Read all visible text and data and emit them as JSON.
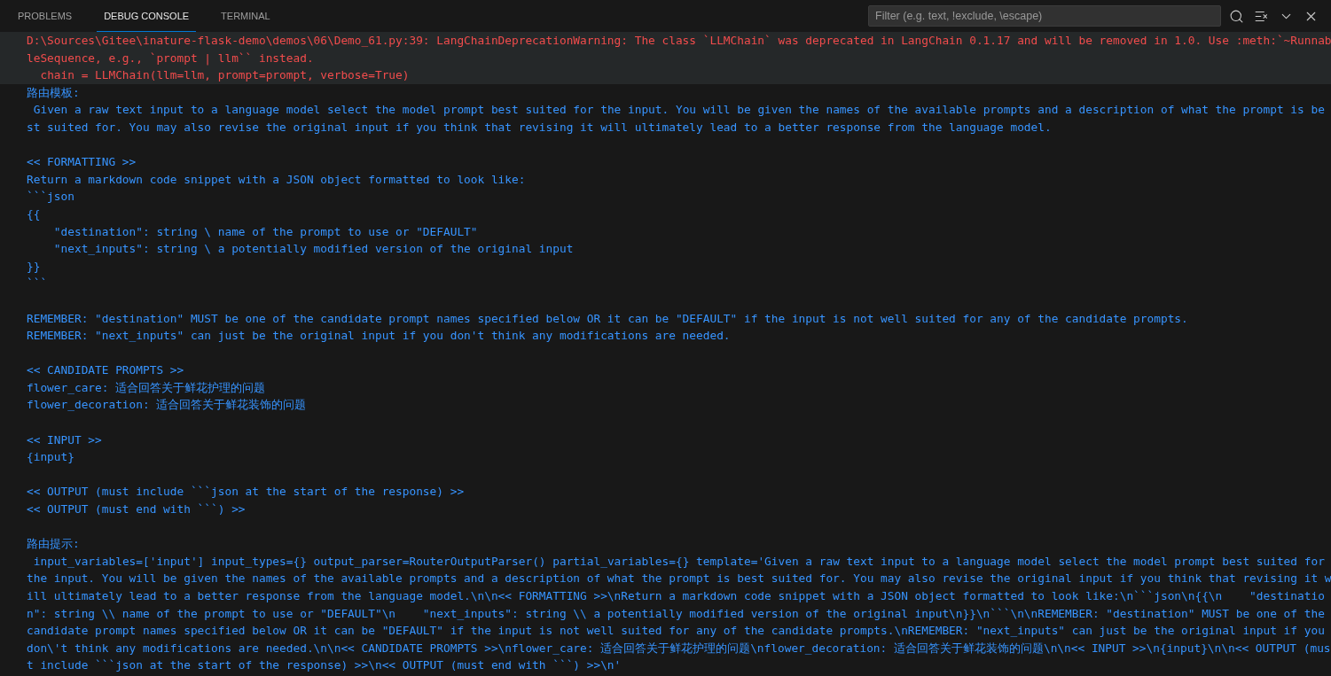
{
  "panel_tabs": [
    {
      "label": "PROBLEMS",
      "selected": false
    },
    {
      "label": "DEBUG CONSOLE",
      "selected": true
    },
    {
      "label": "TERMINAL",
      "selected": false
    }
  ],
  "filter": {
    "placeholder": "Filter (e.g. text, !exclude, \\escape)"
  },
  "console": [
    {
      "kind": "warning",
      "blocks": [
        [
          "D:\\Sources\\Gitee\\inature-flask-demo\\demos\\06\\Demo_61.py:39: LangChainDeprecationWarning: The class `LLMChain` was deprecated in LangChain 0.1.17 and will be removed in 1.0. Use :meth:`~RunnableSequence, e.g., `prompt | llm`` instead.",
          "  chain = LLMChain(llm=llm, prompt=prompt, verbose=True)"
        ]
      ]
    },
    {
      "kind": "output",
      "blocks": [
        [
          "路由模板:",
          " Given a raw text input to a language model select the model prompt best suited for the input. You will be given the names of the available prompts and a description of what the prompt is best suited for. You may also revise the original input if you think that revising it will ultimately lead to a better response from the language model."
        ],
        [
          "<< FORMATTING >>",
          "Return a markdown code snippet with a JSON object formatted to look like:",
          "```json",
          "{{",
          "    \"destination\": string \\ name of the prompt to use or \"DEFAULT\"",
          "    \"next_inputs\": string \\ a potentially modified version of the original input",
          "}}",
          "```"
        ],
        [
          "REMEMBER: \"destination\" MUST be one of the candidate prompt names specified below OR it can be \"DEFAULT\" if the input is not well suited for any of the candidate prompts.",
          "REMEMBER: \"next_inputs\" can just be the original input if you don't think any modifications are needed."
        ],
        [
          "<< CANDIDATE PROMPTS >>",
          "flower_care: 适合回答关于鲜花护理的问题",
          "flower_decoration: 适合回答关于鲜花装饰的问题"
        ],
        [
          "<< INPUT >>",
          "{input}"
        ],
        [
          "<< OUTPUT (must include ```json at the start of the response) >>",
          "<< OUTPUT (must end with ```) >>"
        ],
        [
          "路由提示:",
          " input_variables=['input'] input_types={} output_parser=RouterOutputParser() partial_variables={} template='Given a raw text input to a language model select the model prompt best suited for the input. You will be given the names of the available prompts and a description of what the prompt is best suited for. You may also revise the original input if you think that revising it will ultimately lead to a better response from the language model.\\n\\n<< FORMATTING >>\\nReturn a markdown code snippet with a JSON object formatted to look like:\\n```json\\n{{\\n    \"destination\": string \\\\ name of the prompt to use or \"DEFAULT\"\\n    \"next_inputs\": string \\\\ a potentially modified version of the original input\\n}}\\n```\\n\\nREMEMBER: \"destination\" MUST be one of the candidate prompt names specified below OR it can be \"DEFAULT\" if the input is not well suited for any of the candidate prompts.\\nREMEMBER: \"next_inputs\" can just be the original input if you don\\'t think any modifications are needed.\\n\\n<< CANDIDATE PROMPTS >>\\nflower_care: 适合回答关于鲜花护理的问题\\nflower_decoration: 适合回答关于鲜花装饰的问题\\n\\n<< INPUT >>\\n{input}\\n\\n<< OUTPUT (must include ```json at the start of the response) >>\\n<< OUTPUT (must end with ```) >>\\n'"
        ]
      ]
    }
  ]
}
